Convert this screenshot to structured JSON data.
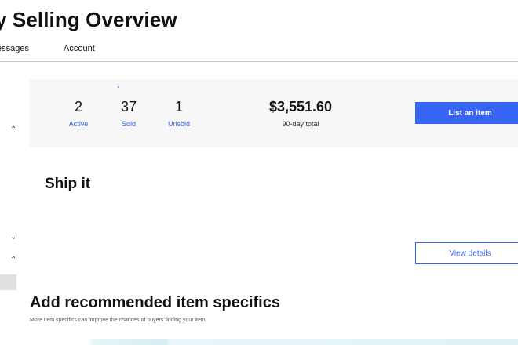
{
  "header": {
    "title": "y Selling Overview",
    "tabs": [
      {
        "label": "essages"
      },
      {
        "label": "Account"
      }
    ]
  },
  "summary": {
    "stats": [
      {
        "value": "2",
        "label": "Active"
      },
      {
        "value": "37",
        "label": "Sold"
      },
      {
        "value": "1",
        "label": "Unsold"
      }
    ],
    "total": {
      "value": "$3,551.60",
      "label": "90-day total"
    },
    "list_button_label": "List an item"
  },
  "ship_it": {
    "heading": "Ship it",
    "view_details_label": "View details"
  },
  "specifics": {
    "heading": "Add recommended item specifics",
    "subtext": "More item specifics can improve the chances of buyers finding your item."
  },
  "icons": {
    "collapse": "chevron-up-icon",
    "expand": "chevron-down-icon"
  },
  "colors": {
    "accent": "#3665f3",
    "panel_bg": "#f7f7f7",
    "text": "#111111"
  }
}
